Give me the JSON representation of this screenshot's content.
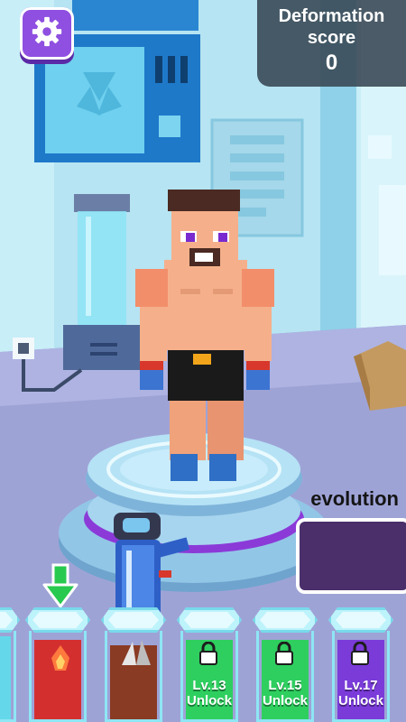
{
  "hud": {
    "score_title": "Deformation score",
    "score_value": "0",
    "evolution_label": "evolution"
  },
  "icons": {
    "settings": "gear-icon",
    "down_arrow": "arrow-down-icon",
    "lock": "lock-icon"
  },
  "slots": [
    {
      "state": "unlocked",
      "color": "#d42f2f"
    },
    {
      "state": "unlocked",
      "color": "#8a3b24"
    },
    {
      "line1": "Lv.13",
      "line2": "Unlock",
      "color": "#2ecf5f"
    },
    {
      "line1": "Lv.15",
      "line2": "Unlock",
      "color": "#2ecf5f"
    },
    {
      "line1": "Lv.17",
      "line2": "Unlock",
      "color": "#7a3bd9"
    }
  ],
  "colors": {
    "accent": "#8f4fe0",
    "evolution_bar": "#4a2f6b",
    "arrow": "#28c94f"
  }
}
